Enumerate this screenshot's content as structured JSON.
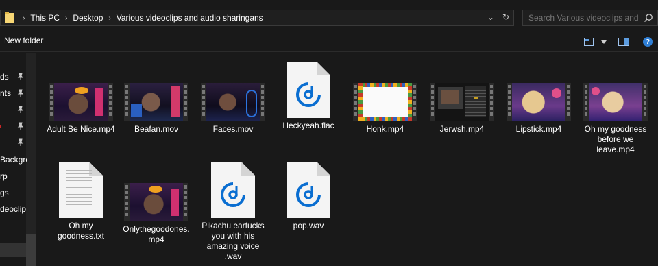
{
  "breadcrumb": {
    "items": [
      "This PC",
      "Desktop",
      "Various videoclips and audio sharingans"
    ]
  },
  "search": {
    "placeholder": "Search Various videoclips and ..."
  },
  "toolbar": {
    "new_folder": "New folder"
  },
  "sidebar": {
    "items": [
      {
        "label": "ds",
        "pinned": true
      },
      {
        "label": "nts",
        "pinned": true
      },
      {
        "label": "",
        "pinned": true
      },
      {
        "label": "",
        "pinned": true
      },
      {
        "label": "",
        "pinned": true
      },
      {
        "label": "Backgro",
        "pinned": false
      },
      {
        "label": "rp",
        "pinned": false
      },
      {
        "label": "gs",
        "pinned": false
      },
      {
        "label": "deoclip",
        "pinned": false
      }
    ]
  },
  "files": [
    {
      "name": "Adult Be Nice.mp4",
      "kind": "video"
    },
    {
      "name": "Beafan.mov",
      "kind": "video"
    },
    {
      "name": "Faces.mov",
      "kind": "video"
    },
    {
      "name": "Heckyeah.flac",
      "kind": "audio"
    },
    {
      "name": "Honk.mp4",
      "kind": "video"
    },
    {
      "name": "Jerwsh.mp4",
      "kind": "video"
    },
    {
      "name": "Lipstick.mp4",
      "kind": "video"
    },
    {
      "name": "Oh my goodness before we leave.mp4",
      "kind": "video"
    },
    {
      "name": "Oh my goodness.txt",
      "kind": "text"
    },
    {
      "name": "Onlythegoodones.mp4",
      "kind": "video"
    },
    {
      "name": "Pikachu earfucks you with his amazing voice .wav",
      "kind": "audio"
    },
    {
      "name": "pop.wav",
      "kind": "audio"
    }
  ],
  "colors": {
    "background": "#191919",
    "accent": "#0a6ed1",
    "folder": "#f8d775"
  }
}
